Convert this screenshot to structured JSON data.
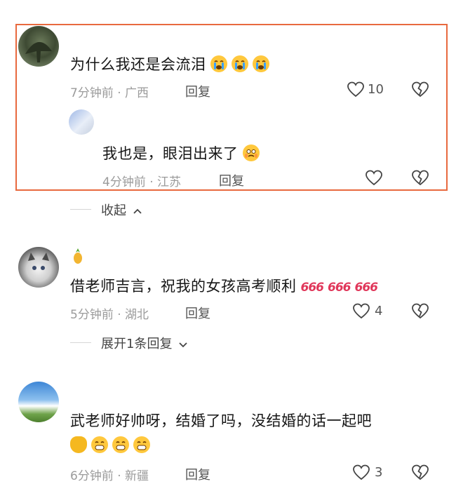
{
  "colors": {
    "highlight_border": "#e8693e",
    "meta_text": "#9b9b9b",
    "emoji_yellow": "#ffc83d",
    "six_red": "#e0375a"
  },
  "comments": [
    {
      "name": "",
      "text": "为什么我还是会流泪",
      "emojis": [
        "crying-emoji",
        "crying-emoji",
        "crying-emoji"
      ],
      "time_location": "7分钟前 · 广西",
      "reply_label": "回复",
      "like_count": "10",
      "replies": [
        {
          "name": "",
          "text": "我也是，眼泪出来了",
          "emojis": [
            "teary-emoji"
          ],
          "time_location": "4分钟前 · 江苏",
          "reply_label": "回复",
          "like_count": ""
        }
      ],
      "toggle_label": "收起"
    },
    {
      "name": "",
      "text": "借老师吉言，祝我的女孩高考顺利",
      "emojis": [
        "666-sticker",
        "666-sticker",
        "666-sticker"
      ],
      "sticker_text": "666",
      "time_location": "5分钟前 · 湖北",
      "reply_label": "回复",
      "like_count": "4",
      "toggle_label": "展开1条回复"
    },
    {
      "name": "",
      "text_line1": "武老师好帅呀，结婚了吗，没结婚的话一起吧",
      "emojis": [
        "lucky-bag-emoji",
        "grin-emoji",
        "grin-emoji",
        "grin-emoji"
      ],
      "time_location": "6分钟前 · 新疆",
      "reply_label": "回复",
      "like_count": "3"
    }
  ]
}
